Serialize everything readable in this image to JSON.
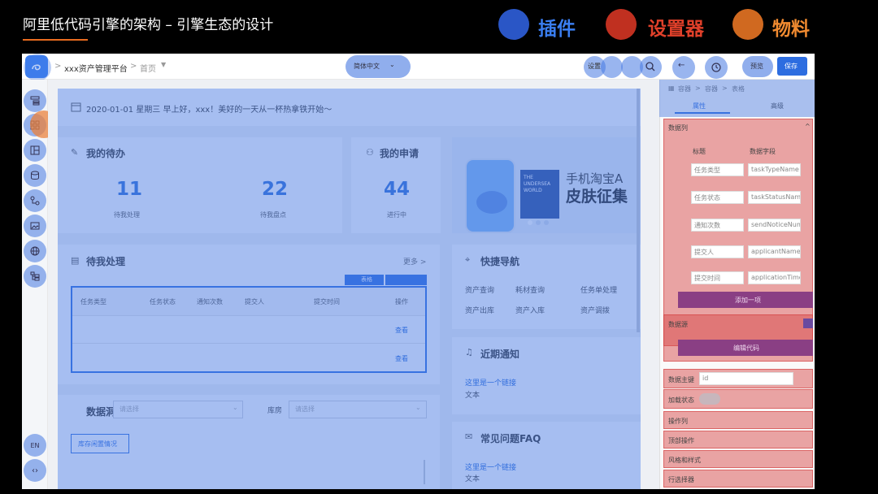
{
  "slide": {
    "title": "阿里低代码引擎的架构 – 引擎生态的设计",
    "legend": [
      {
        "label": "插件",
        "color": "#2a56c6"
      },
      {
        "label": "设置器",
        "color": "#c03020"
      },
      {
        "label": "物料",
        "color": "#d06920"
      }
    ]
  },
  "topbar": {
    "app_name": "xxx资产管理平台",
    "page_name": "首页",
    "language": "简体中文",
    "action_a": "设置",
    "preview_label": "预览",
    "save_label": "保存"
  },
  "leftbar": {
    "lang_label": "EN"
  },
  "canvas": {
    "greeting": "2020-01-01 星期三  早上好，xxx！美好的一天从一杯热拿铁开始～",
    "todo": {
      "title": "我的待办",
      "stats": [
        {
          "value": "11",
          "label": "待我处理"
        },
        {
          "value": "22",
          "label": "待我盘点"
        }
      ]
    },
    "apply": {
      "title": "我的申请",
      "value": "44",
      "label": "进行中"
    },
    "banner": {
      "line1": "手机淘宝A",
      "line2": "皮肤征集",
      "phone_text": "THE UNDERSEA WORLD"
    },
    "pending": {
      "title": "待我处理",
      "more": "更多 >",
      "table_label": "表格",
      "columns": [
        "任务类型",
        "任务状态",
        "通知次数",
        "提交人",
        "提交时间",
        "操作"
      ],
      "rows": [
        {
          "action": "查看"
        },
        {
          "action": "查看"
        }
      ]
    },
    "quicknav": {
      "title": "快捷导航",
      "items": [
        "资产查询",
        "耗材查询",
        "任务单处理",
        "资产出库",
        "资产入库",
        "资产调拨"
      ]
    },
    "notice": {
      "title": "近期通知",
      "link": "这里是一个链接",
      "text": "文本"
    },
    "faq": {
      "title": "常见问题FAQ",
      "link": "这里是一个链接",
      "text": "文本"
    },
    "data_section": {
      "title": "数据洞",
      "select1_placeholder": "请选择",
      "warehouse_label": "库房",
      "select2_placeholder": "请选择",
      "tab": "库存闲置情况"
    }
  },
  "panel": {
    "breadcrumb": [
      "容器",
      "容器",
      "表格"
    ],
    "tabs": [
      "属性",
      "高级"
    ],
    "section_datacol": "数据列",
    "col_headers": [
      "标题",
      "数据字段"
    ],
    "rows": [
      {
        "title": "任务类型",
        "field": "taskTypeName"
      },
      {
        "title": "任务状态",
        "field": "taskStatusName"
      },
      {
        "title": "通知次数",
        "field": "sendNoticeNum"
      },
      {
        "title": "提交人",
        "field": "applicantName"
      },
      {
        "title": "提交时间",
        "field": "applicationTime"
      }
    ],
    "add_one": "添加一项",
    "section_datasource": "数据源",
    "edit_code": "编辑代码",
    "primary_key_label": "数据主键",
    "primary_key_value": "id",
    "loading_label": "加载状态",
    "more_sections": [
      "操作列",
      "顶部操作",
      "风格和样式",
      "行选择器"
    ]
  }
}
